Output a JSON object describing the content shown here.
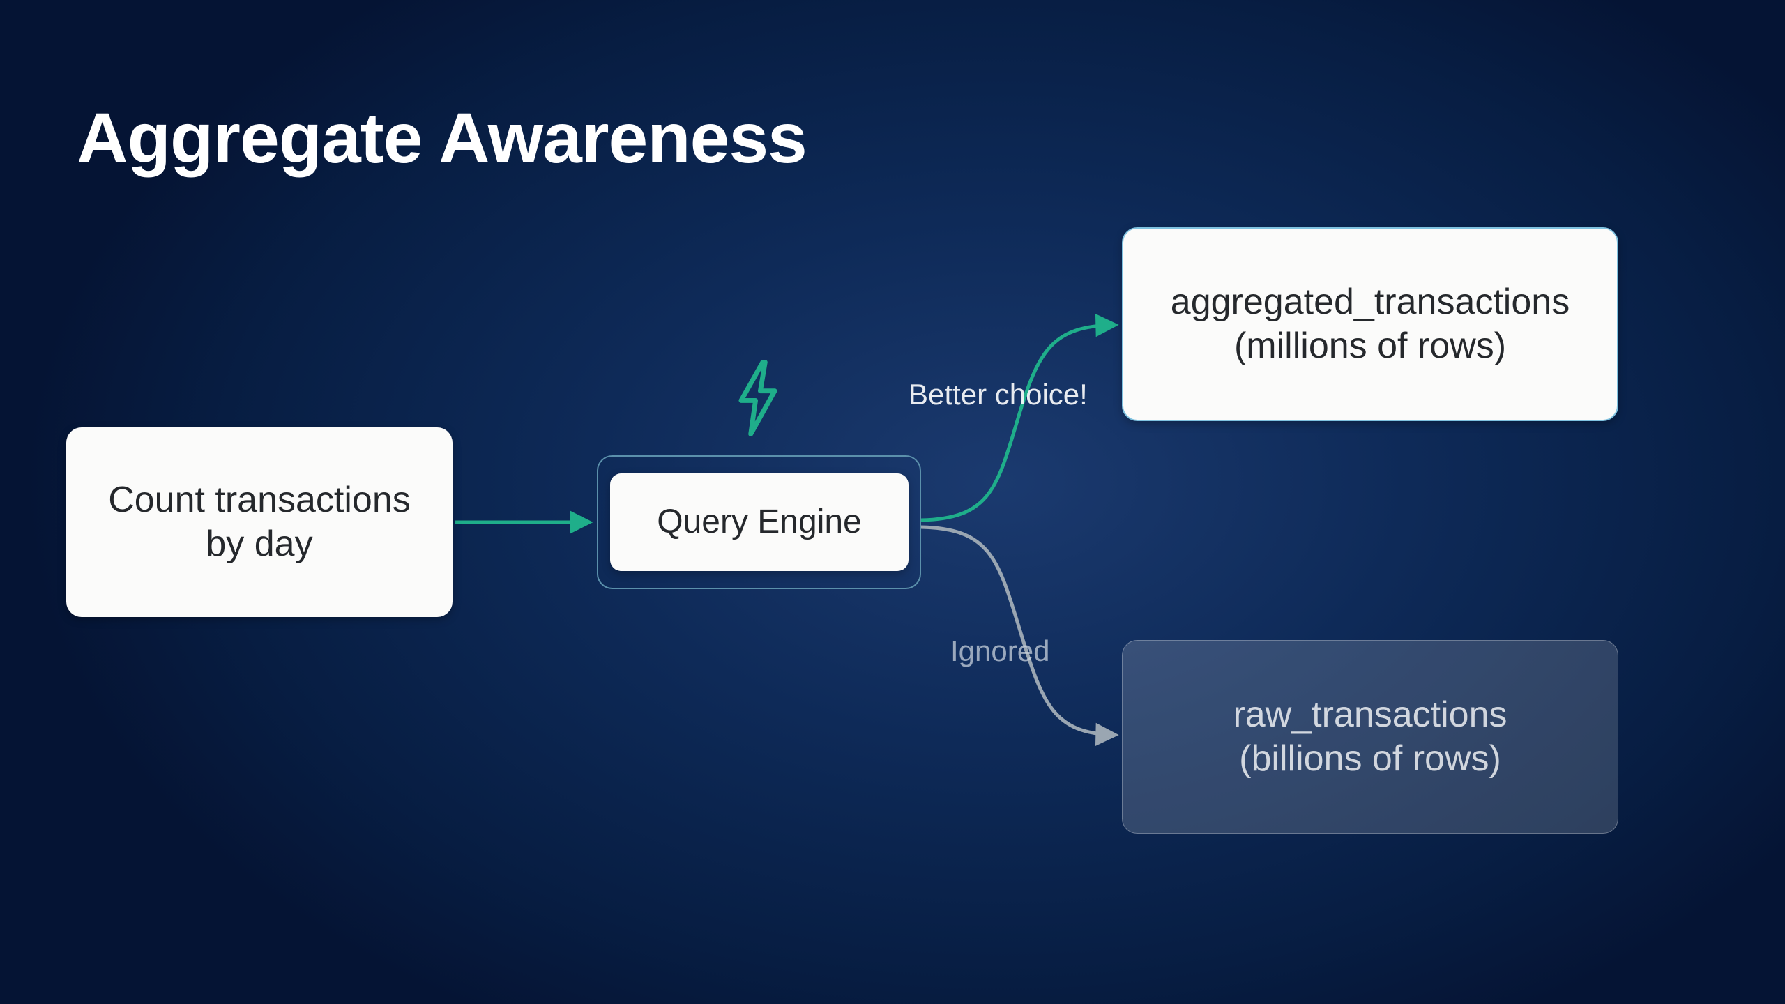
{
  "title": "Aggregate Awareness",
  "nodes": {
    "source": {
      "line1": "Count transactions",
      "line2": "by day"
    },
    "engine": {
      "label": "Query Engine"
    },
    "aggregated": {
      "line1": "aggregated_transactions",
      "line2": "(millions of rows)"
    },
    "raw": {
      "line1": "raw_transactions",
      "line2": "(billions of rows)"
    }
  },
  "edges": {
    "better": {
      "label": "Better choice!"
    },
    "ignored": {
      "label": "Ignored"
    }
  },
  "icons": {
    "lightning": "lightning-icon"
  },
  "colors": {
    "accent_green": "#1fae8a",
    "muted_gray": "#9aa6b2",
    "node_bg": "#fbfbfa",
    "node_text": "#25282c"
  }
}
